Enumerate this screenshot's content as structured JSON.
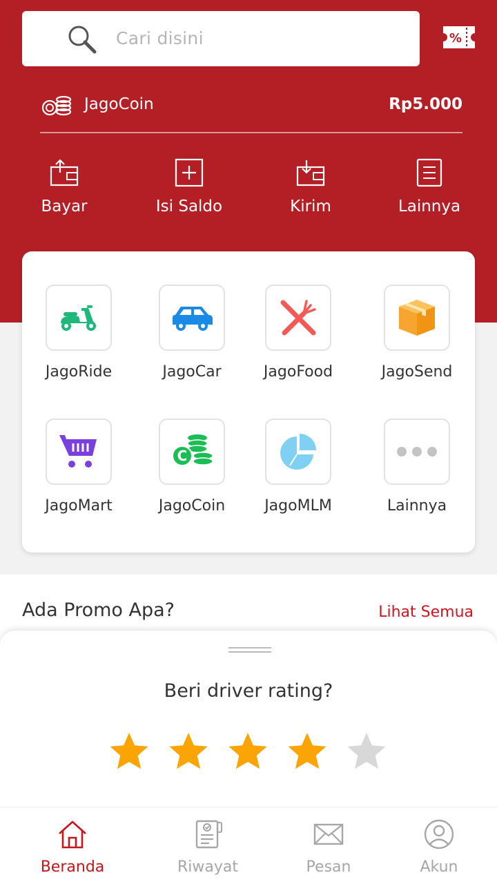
{
  "search": {
    "placeholder": "Cari disini",
    "icon": "search-icon"
  },
  "header": {
    "voucher_icon": "voucher-icon"
  },
  "wallet": {
    "label": "JagoCoin",
    "balance": "Rp5.000",
    "icon": "coins-icon"
  },
  "actions": [
    {
      "label": "Bayar",
      "icon": "pay-icon"
    },
    {
      "label": "Isi Saldo",
      "icon": "topup-icon"
    },
    {
      "label": "Kirim",
      "icon": "send-icon"
    },
    {
      "label": "Lainnya",
      "icon": "menu-list-icon"
    }
  ],
  "services": [
    {
      "label": "JagoRide",
      "icon": "scooter-icon",
      "color": "#1db87a"
    },
    {
      "label": "JagoCar",
      "icon": "car-icon",
      "color": "#1a8ae6"
    },
    {
      "label": "JagoFood",
      "icon": "fork-knife-icon",
      "color": "#f25a55"
    },
    {
      "label": "JagoSend",
      "icon": "package-icon",
      "color": "#f7a531"
    },
    {
      "label": "JagoMart",
      "icon": "cart-icon",
      "color": "#7b3fe0"
    },
    {
      "label": "JagoCoin",
      "icon": "coins-stack-icon",
      "color": "#1cbd55"
    },
    {
      "label": "JagoMLM",
      "icon": "pie-chart-icon",
      "color": "#7fd0f2"
    },
    {
      "label": "Lainnya",
      "icon": "more-dots-icon",
      "color": "#c4c4c4"
    }
  ],
  "promo": {
    "title": "Ada Promo Apa?",
    "link": "Lihat Semua"
  },
  "rating": {
    "title": "Beri driver rating?",
    "value": 4,
    "max": 5
  },
  "nav": [
    {
      "label": "Beranda",
      "icon": "home-icon",
      "active": true
    },
    {
      "label": "Riwayat",
      "icon": "history-icon",
      "active": false
    },
    {
      "label": "Pesan",
      "icon": "mail-icon",
      "active": false
    },
    {
      "label": "Akun",
      "icon": "account-icon",
      "active": false
    }
  ],
  "colors": {
    "brand": "#b41f26",
    "accent": "#d3131e",
    "star_on": "#fba406",
    "star_off": "#d8d8d8"
  }
}
